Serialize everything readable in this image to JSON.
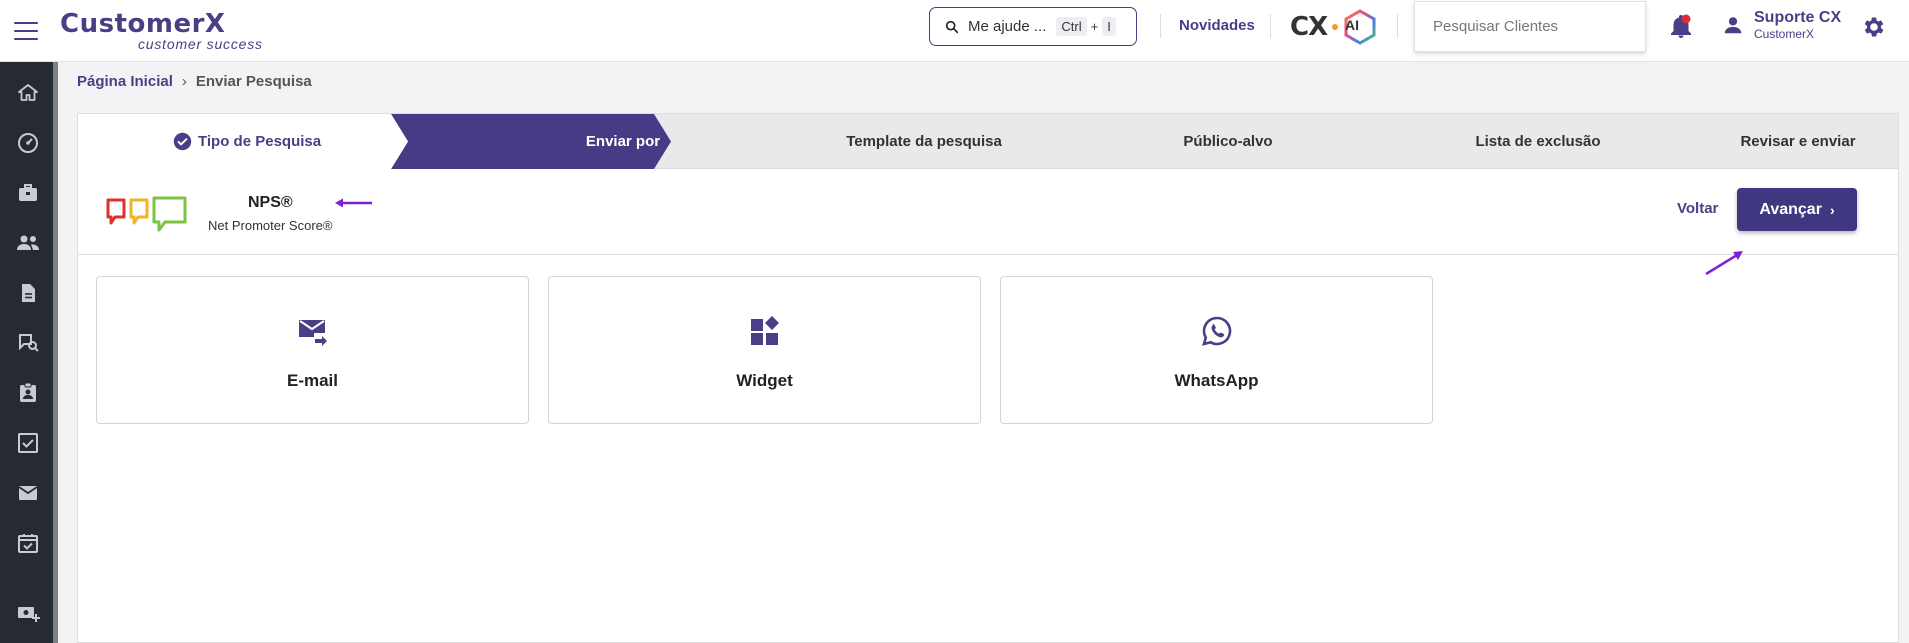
{
  "header": {
    "logo_main": "CustomerX",
    "logo_sub": "customer success",
    "help_search": {
      "label": "Me ajude ...",
      "key1": "Ctrl",
      "plus": "+",
      "key2": "I"
    },
    "novidades": "Novidades",
    "cx_ai": {
      "cx": "CX",
      "ai": "AI"
    },
    "client_search_placeholder": "Pesquisar Clientes",
    "user": {
      "name": "Suporte CX",
      "org": "CustomerX"
    }
  },
  "sidebar": {
    "items": [
      {
        "icon": "home-icon"
      },
      {
        "icon": "dashboard-icon"
      },
      {
        "icon": "briefcase-icon"
      },
      {
        "icon": "people-icon"
      },
      {
        "icon": "document-icon"
      },
      {
        "icon": "chat-search-icon"
      },
      {
        "icon": "clipboard-user-icon"
      },
      {
        "icon": "checkbox-icon"
      },
      {
        "icon": "mail-icon"
      },
      {
        "icon": "calendar-check-icon"
      },
      {
        "icon": "money-add-icon"
      }
    ]
  },
  "breadcrumb": {
    "home": "Página Inicial",
    "separator": "›",
    "current": "Enviar Pesquisa"
  },
  "steps": [
    {
      "label": "Tipo de Pesquisa",
      "state": "done"
    },
    {
      "label": "Enviar por",
      "state": "active"
    },
    {
      "label": "Template da pesquisa",
      "state": "pending"
    },
    {
      "label": "Público-alvo",
      "state": "pending"
    },
    {
      "label": "Lista de exclusão",
      "state": "pending"
    },
    {
      "label": "Revisar e enviar",
      "state": "pending"
    }
  ],
  "survey": {
    "title": "NPS®",
    "subtitle": "Net Promoter Score®"
  },
  "actions": {
    "back": "Voltar",
    "next": "Avançar",
    "next_chevron": "›"
  },
  "channels": [
    {
      "label": "E-mail",
      "icon": "email-forward-icon"
    },
    {
      "label": "Widget",
      "icon": "widget-icon"
    },
    {
      "label": "WhatsApp",
      "icon": "whatsapp-icon"
    }
  ],
  "colors": {
    "primary": "#4a3f86",
    "button": "#3f3780",
    "annotation_arrow": "#7b22d6",
    "sidebar": "#262a33"
  }
}
